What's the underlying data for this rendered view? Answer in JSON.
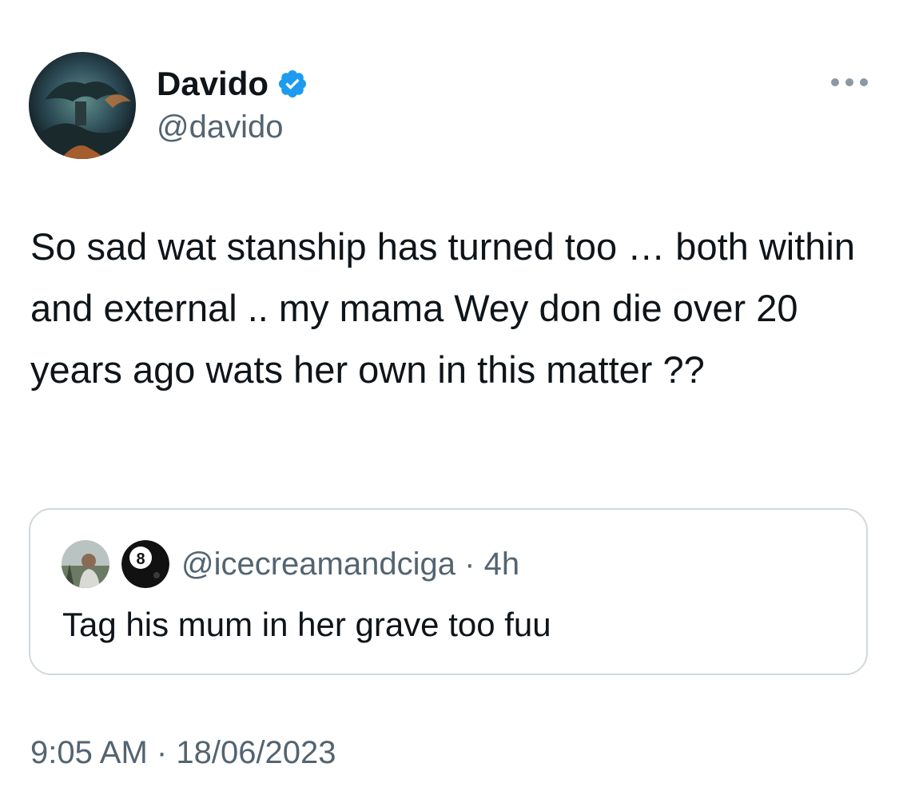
{
  "author": {
    "display_name": "Davido",
    "handle": "@davido",
    "verified": true,
    "verified_color": "#1d9bf0"
  },
  "tweet": {
    "text": "So sad wat stanship has turned too … both within and external .. my mama Wey don die over 20 years ago wats her own in this matter ??"
  },
  "quoted_tweet": {
    "handle": "@icecreamandciga",
    "separator": "·",
    "age": "4h",
    "text": "Tag his mum in her grave too fuu",
    "badge_icon": "8-ball-icon"
  },
  "meta": {
    "time": "9:05 AM",
    "separator": "·",
    "date": "18/06/2023"
  },
  "icons": {
    "more": "more-horizontal-icon",
    "verified": "verified-badge-icon"
  }
}
